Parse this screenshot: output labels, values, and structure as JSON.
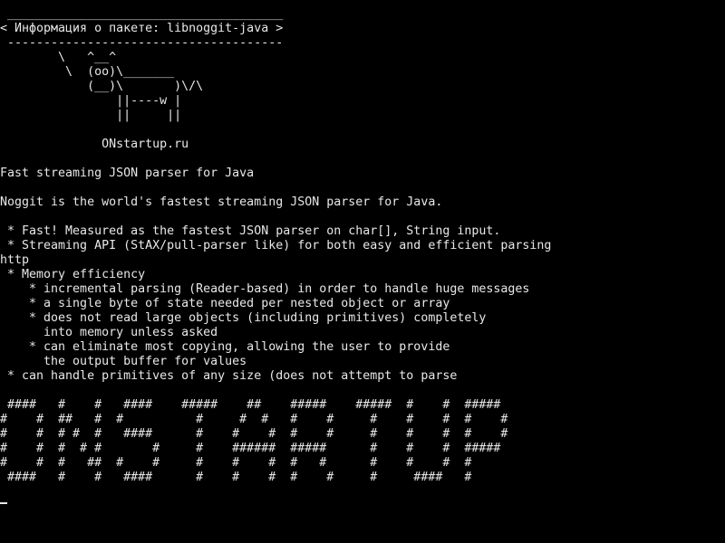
{
  "terminal": {
    "lines": [
      " ______________________________________",
      "< Информация о пакете: libnoggit-java >",
      " --------------------------------------",
      "        \\   ^__^",
      "         \\  (oo)\\_______",
      "            (__)\\       )\\/\\",
      "                ||----w |",
      "                ||     ||",
      "",
      "              ONstartup.ru",
      "",
      "Fast streaming JSON parser for Java",
      "",
      "Noggit is the world's fastest streaming JSON parser for Java.",
      "",
      " * Fast! Measured as the fastest JSON parser on char[], String input.",
      " * Streaming API (StAX/pull-parser like) for both easy and efficient parsing",
      "http",
      " * Memory efficiency",
      "    * incremental parsing (Reader-based) in order to handle huge messages",
      "    * a single byte of state needed per nested object or array",
      "    * does not read large objects (including primitives) completely",
      "      into memory unless asked",
      "    * can eliminate most copying, allowing the user to provide",
      "      the output buffer for values",
      " * can handle primitives of any size (does not attempt to parse",
      "",
      " ####   #    #   ####    #####    ##    #####    #####  #    #  #####",
      "#    #  ##   #  #          #     #  #   #    #     #    #    #  #    #",
      "#    #  # #  #   ####      #    #    #  #    #     #    #    #  #    #",
      "#    #  #  # #       #     #    ######  #####      #    #    #  #####",
      "#    #  #   ##  #    #     #    #    #  #   #      #    #    #  #",
      " ####   #    #   ####      #    #    #  #    #     #     ####   #"
    ],
    "cursor": "_"
  }
}
